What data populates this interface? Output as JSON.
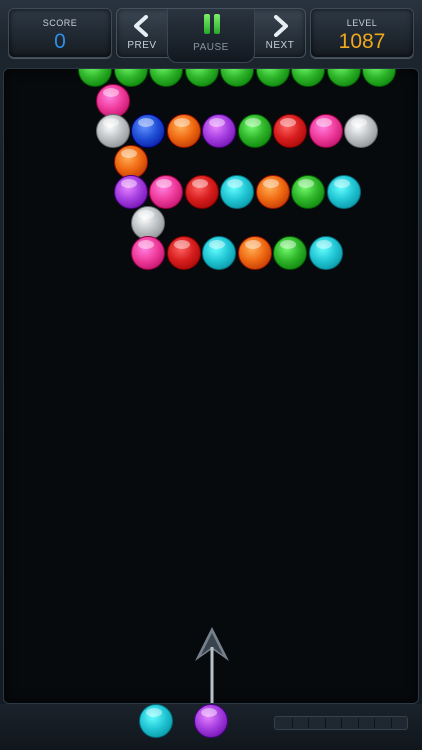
{
  "hud": {
    "score_label": "SCORE",
    "score_value": "0",
    "level_label": "LEVEL",
    "level_value": "1087",
    "prev_label": "PREV",
    "pause_label": "PAUSE",
    "next_label": "NEXT"
  },
  "colors": {
    "green": "#2fb52a",
    "pink": "#f03c9c",
    "gray": "#bfc3c6",
    "blue": "#1f4fd6",
    "orange": "#f06a12",
    "purple": "#a43ee0",
    "red": "#d81e1e",
    "cyan": "#22c7d6",
    "score_blue": "#2f8ee6",
    "level_gold": "#f0a81c"
  },
  "board": {
    "rows": [
      [
        "green",
        "green",
        "green",
        "green",
        "green",
        "green",
        "green",
        "green",
        "green"
      ],
      [
        "pink"
      ],
      [
        "gray",
        "blue",
        "orange",
        "purple",
        "green",
        "red",
        "pink",
        "gray"
      ],
      [
        "orange"
      ],
      [
        "purple",
        "pink",
        "red",
        "cyan",
        "orange",
        "green",
        "cyan"
      ],
      [
        "gray"
      ],
      [
        "pink",
        "red",
        "cyan",
        "orange",
        "green",
        "cyan"
      ]
    ],
    "row_offsets": [
      0,
      0,
      1,
      1,
      2,
      2,
      3
    ]
  },
  "shooter": {
    "next_bubble": "cyan",
    "current_bubble": "purple",
    "aim_direction": "up"
  },
  "progress": {
    "fill_fraction": 0.0,
    "segments": 8
  }
}
